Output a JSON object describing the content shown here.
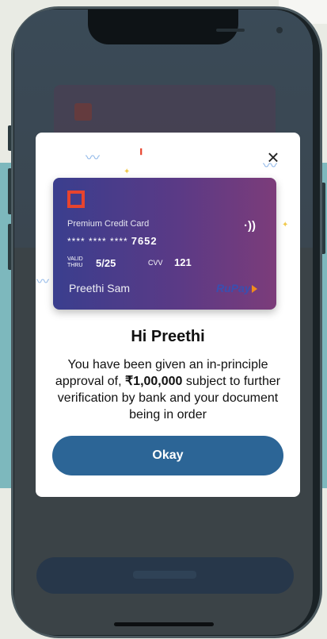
{
  "modal": {
    "close_icon": "close-icon",
    "title": "Hi Preethi",
    "message_prefix": "You have been given an in-principle approval of, ",
    "amount": "₹1,00,000",
    "message_suffix": " subject to further verification by bank and your document being in order",
    "okay_label": "Okay"
  },
  "card": {
    "type": "Premium Credit Card",
    "masked_number": "**** **** ****",
    "last_digits": "7652",
    "contactless_icon": "contactless-icon",
    "valid_label_1": "VALID",
    "valid_label_2": "THRU",
    "valid_thru": "5/25",
    "cvv_label": "CVV",
    "cvv": "121",
    "holder": "Preethi Sam",
    "network": "RuPay"
  },
  "colors": {
    "primary_button": "#2c6596",
    "card_logo": "#e8442e",
    "background_teal": "#7db8bd"
  }
}
